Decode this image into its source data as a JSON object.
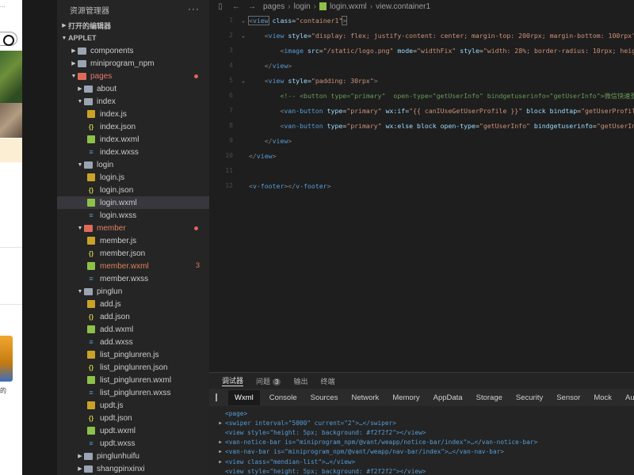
{
  "simulator": {
    "status_text": "...",
    "snippet_text": "的"
  },
  "explorer": {
    "title": "资源管理器",
    "more": "···",
    "open_editors": "打开的编辑器",
    "project": "APPLET",
    "items": [
      {
        "name": "components"
      },
      {
        "name": "miniprogram_npm"
      },
      {
        "name": "pages"
      },
      {
        "name": "about"
      },
      {
        "name": "index"
      },
      {
        "name": "index.js"
      },
      {
        "name": "index.json"
      },
      {
        "name": "index.wxml"
      },
      {
        "name": "index.wxss"
      },
      {
        "name": "login"
      },
      {
        "name": "login.js"
      },
      {
        "name": "login.json"
      },
      {
        "name": "login.wxml"
      },
      {
        "name": "login.wxss"
      },
      {
        "name": "member"
      },
      {
        "name": "member.js"
      },
      {
        "name": "member.json"
      },
      {
        "name": "member.wxml",
        "problems": "3"
      },
      {
        "name": "member.wxss"
      },
      {
        "name": "pinglun"
      },
      {
        "name": "add.js"
      },
      {
        "name": "add.json"
      },
      {
        "name": "add.wxml"
      },
      {
        "name": "add.wxss"
      },
      {
        "name": "list_pinglunren.js"
      },
      {
        "name": "list_pinglunren.json"
      },
      {
        "name": "list_pinglunren.wxml"
      },
      {
        "name": "list_pinglunren.wxss"
      },
      {
        "name": "updt.js"
      },
      {
        "name": "updt.json"
      },
      {
        "name": "updt.wxml"
      },
      {
        "name": "updt.wxss"
      },
      {
        "name": "pinglunhuifu"
      },
      {
        "name": "shangpinxinxi"
      }
    ]
  },
  "editor": {
    "breadcrumb": [
      "pages",
      "login",
      "login.wxml",
      "view.container1"
    ],
    "line_numbers": [
      "1",
      "2",
      "3",
      "4",
      "5",
      "6",
      "7",
      "8",
      "9",
      "10",
      "11",
      "12"
    ],
    "code": {
      "l1_tag": "view",
      "l1_attr": "class",
      "l1_val": "\"container1\"",
      "l2_tag": "view",
      "l2_attr": "style",
      "l2_val": "\"display: flex; justify-content: center; margin-top: 200rpx; margin-bottom: 100rpx\"",
      "l3_tag": "image",
      "l3_a1": "src",
      "l3_v1": "\"/static/logo.png\"",
      "l3_a2": "mode",
      "l3_v2": "\"widthFix\"",
      "l3_a3": "style",
      "l3_v3": "\"width: 28%; border-radius: 10rpx; height:",
      "l4_tag": "view",
      "l5_tag": "view",
      "l5_attr": "style",
      "l5_val": "\"padding: 30rpx\"",
      "l6_comment": "<!-- <button type=\"primary\"  open-type=\"getUserInfo\" bindgetuserinfo=\"getUserInfo\">微信快速登录",
      "l7_tag": "van-button",
      "l7_a1": "type",
      "l7_v1": "\"primary\"",
      "l7_a2": "wx:if",
      "l7_v2": "\"{{ canIUseGetUserProfile }}\"",
      "l7_a3": "block bindtap",
      "l7_v3": "\"getUserProfile\"",
      "l8_tag": "van-button",
      "l8_a1": "type",
      "l8_v1": "\"primary\"",
      "l8_a2": "wx:else block open-type",
      "l8_v2": "\"getUserInfo\"",
      "l8_a3": "bindgetuserinfo",
      "l8_v3": "\"getUserInfo\"",
      "l9_tag": "view",
      "l10_tag": "view",
      "l12_tag": "v-footer",
      "l12_close": "v-footer"
    }
  },
  "devtools": {
    "top_tabs": [
      {
        "label": "调试器"
      },
      {
        "label": "问题",
        "badge": "3"
      },
      {
        "label": "输出"
      },
      {
        "label": "终端"
      }
    ],
    "tabs": [
      "Wxml",
      "Console",
      "Sources",
      "Network",
      "Memory",
      "AppData",
      "Storage",
      "Security",
      "Sensor",
      "Mock",
      "Audits"
    ],
    "tree": [
      "<page>",
      "<swiper interval=\"5000\" current=\"2\">…</swiper>",
      "<view style=\"height: 5px; background: #f2f2f2\"></view>",
      "<van-notice-bar is=\"miniprogram_npm/@vant/weapp/notice-bar/index\">…</van-notice-bar>",
      "<van-nav-bar is=\"miniprogram_npm/@vant/weapp/nav-bar/index\">…</van-nav-bar>",
      "<view class=\"mendian-list\">…</view>",
      "<view style=\"height: 5px; background: #f2f2f2\"></view>"
    ]
  },
  "colors": {
    "tag": "#569cd6",
    "attribute": "#9cdcfe",
    "string": "#ce9178",
    "comment": "#6a9955",
    "modified_folder": "#e06a5a",
    "background": "#1e1e1e"
  }
}
